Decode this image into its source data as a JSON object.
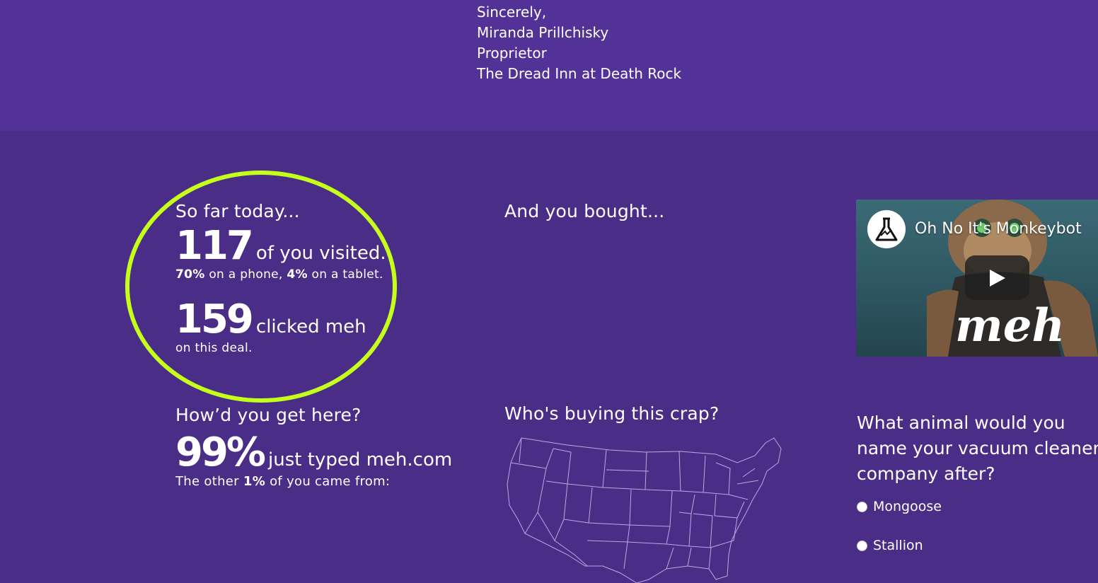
{
  "signoff": {
    "line1": "Sincerely,",
    "line2": "Miranda Prillchisky",
    "line3": "Proprietor",
    "line4": "The Dread Inn at Death Rock"
  },
  "stats": {
    "heading": "So far today...",
    "visited_count": "117",
    "visited_label": "of you visited.",
    "phone_pct": "70%",
    "phone_label": "on a phone,",
    "tablet_pct": "4%",
    "tablet_label": "on a tablet.",
    "clicked_count": "159",
    "clicked_label": "clicked meh",
    "clicked_sub": "on this deal."
  },
  "purchases": {
    "heading": "And you bought..."
  },
  "video": {
    "title": "Oh No It's Monkeybot",
    "shirt_text": "meh"
  },
  "referral": {
    "heading": "How’d you get here?",
    "pct": "99%",
    "pct_label": "just typed meh.com",
    "other_prefix": "The other",
    "other_pct": "1%",
    "other_suffix": "of you came from:"
  },
  "map": {
    "heading": "Who's buying this crap?"
  },
  "poll": {
    "question": "What animal would you name your vacuum cleaner company after?",
    "options": [
      "Mongoose",
      "Stallion"
    ]
  },
  "colors": {
    "background": "#4a2d87",
    "top_band": "#533297",
    "annotation_ring": "#c6ff1a"
  }
}
